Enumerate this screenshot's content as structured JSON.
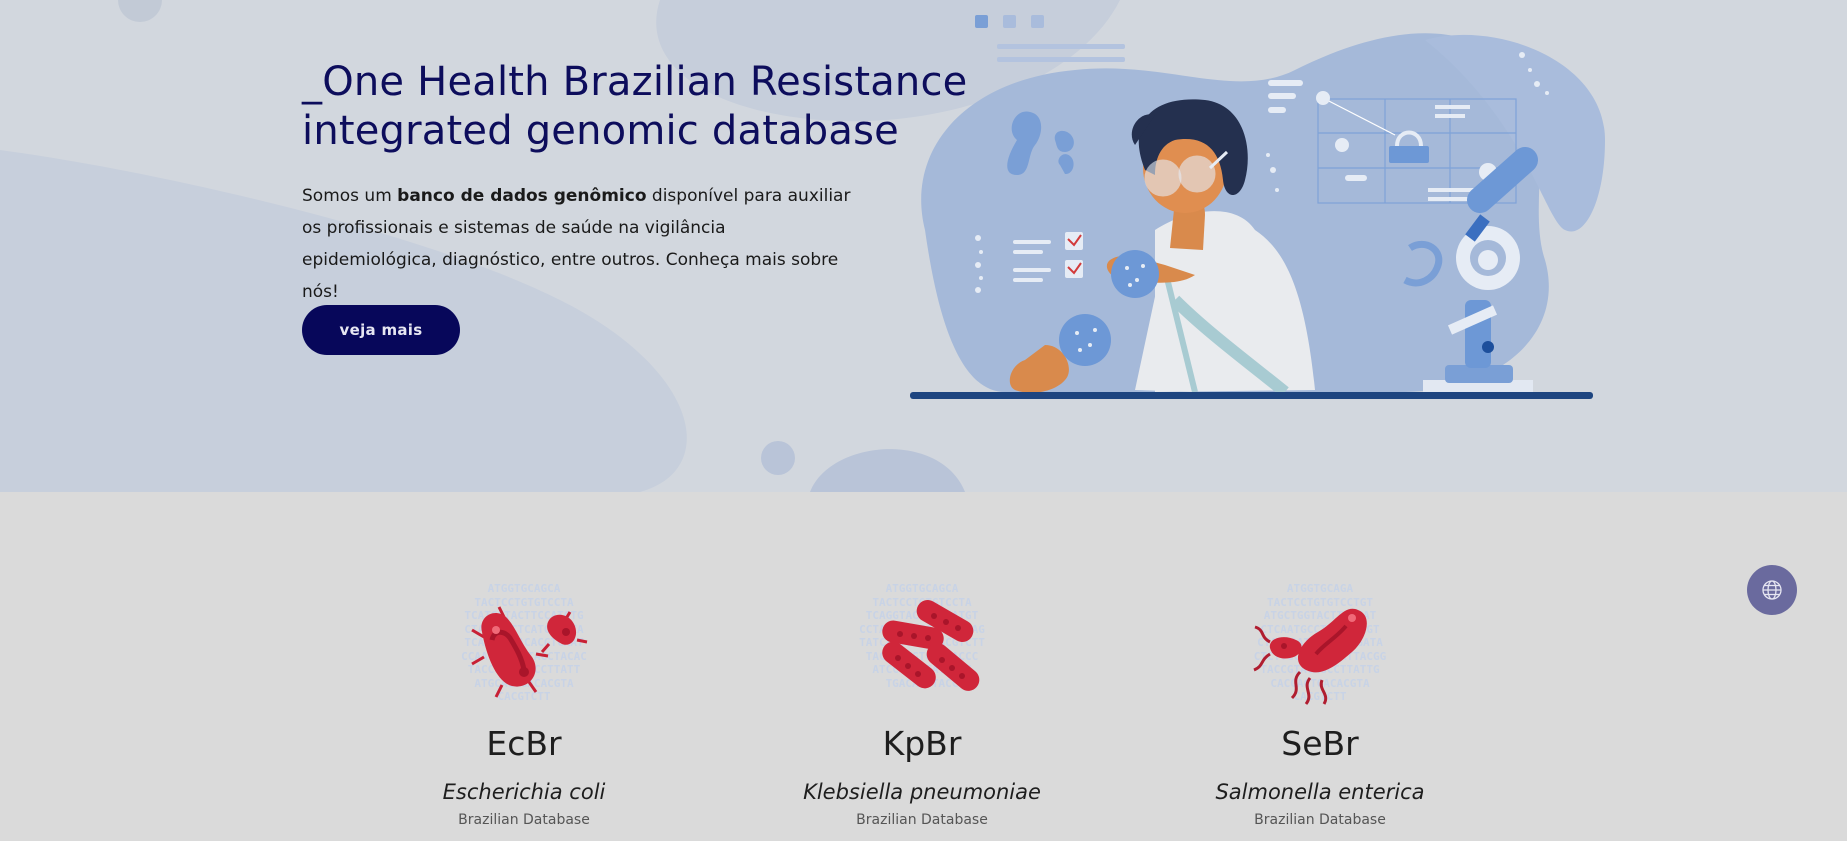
{
  "hero": {
    "title_line1": "_One Health Brazilian Resistance",
    "title_line2": "integrated genomic database",
    "desc_pre": "Somos um ",
    "desc_bold": "banco de dados genômico",
    "desc_post": " disponível para auxiliar os profissionais e sistemas de saúde na vigilância epidemiológica, diagnóstico, entre outros. Conheça mais sobre nós!",
    "cta_label": "veja mais"
  },
  "databases": [
    {
      "abbr": "EcBr",
      "species": "Escherichia coli",
      "subtitle": "Brazilian Database",
      "icon": "e-coli-bacteria-icon",
      "dna": "ATGGTGCAGCA\nTACTCCTGTGTCCTA\nTCATGGTACTTCCATGTG\nCTAATGCCTCATGACGTA\nTCAATTAAACACGTCAAT\nCCAATGTCATTACCTACAC\nTACCGTACAGCCTTATT\nATGCACTGACACGTA\nCACGTCTT"
    },
    {
      "abbr": "KpBr",
      "species": "Klebsiella pneumoniae",
      "subtitle": "Brazilian Database",
      "icon": "klebsiella-bacteria-icon",
      "dna": "ATGGTGCAGCA\nTACTCCTGTGTCCTA\nTCAGGTACTTCCCATGT\nCCTAATGCCTCATGACTAG\nTATCAATTAAACACGTCTT\nTACCAATGTCATTACCC\nATCCTTATTATGCAC\nTGACACGTACC"
    },
    {
      "abbr": "SeBr",
      "species": "Salmonella enterica",
      "subtitle": "Brazilian Database",
      "icon": "salmonella-bacteria-icon",
      "dna": "ATGGTGCAGA\nTACTCCTGTGTCCTGT\nATGCTGGTACTTCCCAT\nCTCAATGCCTCATGACGT\nCTATCAATTAAACACGATA\nCTCTTCCAATGTCATTACGG\nTACCGTACAGCCTTATTG\nCACGACTGACACGTA\nCACGTCTT"
    }
  ],
  "globe_button": {
    "icon": "globe-icon"
  },
  "colors": {
    "navy": "#07075a",
    "hero_bg": "#d2d7de",
    "section_bg": "#dadada",
    "bacteria_red": "#d0263a",
    "globe_bg": "#6a6a9e"
  }
}
